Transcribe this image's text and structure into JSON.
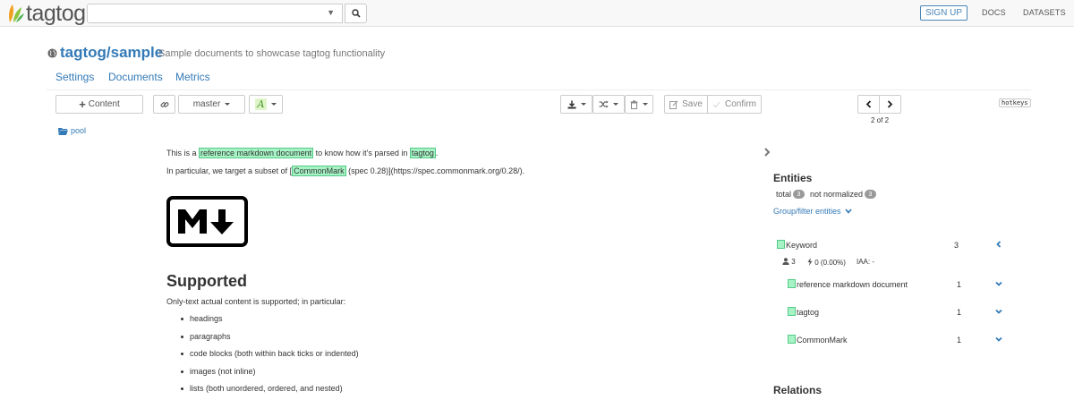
{
  "brand": {
    "name": "tagtog"
  },
  "navbar": {
    "search_value": "",
    "signup_label": "SIGN UP",
    "docs_label": "DOCS",
    "datasets_label": "DATASETS"
  },
  "project": {
    "name": "tagtog/sample",
    "description": "Sample documents to showcase tagtog functionality",
    "tabs": [
      "Settings",
      "Documents",
      "Metrics"
    ]
  },
  "toolbar": {
    "content_label": "Content",
    "branch_label": "master",
    "font_glyph": "A",
    "save_label": "Save",
    "confirm_label": "Confirm",
    "page_indicator": "2 of 2",
    "hotkeys_label": "hotkeys"
  },
  "folder": {
    "label": "pool"
  },
  "document": {
    "line1": {
      "before": "This is a ",
      "hl1": "reference markdown document",
      "middle": " to know how it's parsed in ",
      "hl2": "tagtog",
      "after": "."
    },
    "line2": {
      "before": "In particular, we target a subset of [",
      "hl": "CommonMark",
      "after": " (spec 0.28)](https://spec.commonmark.org/0.28/)."
    },
    "heading": "Supported",
    "intro": "Only-text actual content is supported; in particular:",
    "items": [
      "headings",
      "paragraphs",
      "code blocks (both within back ticks or indented)",
      "images (not inline)",
      "lists (both unordered, ordered, and nested)"
    ]
  },
  "entities_panel": {
    "title": "Entities",
    "total_label": "total",
    "total_count": "3",
    "not_normalized_label": "not normalized",
    "not_normalized_count": "3",
    "group_filter_label": "Group/filter entities",
    "class": {
      "name": "Keyword",
      "count": "3",
      "users": "3",
      "auto": "0 (0.00%)",
      "iaa": "IAA: -"
    },
    "entities": [
      {
        "name": "reference markdown document",
        "count": "1"
      },
      {
        "name": "tagtog",
        "count": "1"
      },
      {
        "name": "CommonMark",
        "count": "1"
      }
    ]
  },
  "relations_panel": {
    "title": "Relations"
  },
  "colors": {
    "accent": "#337ab7",
    "highlight": "#a6f4c5",
    "highlight_border": "#55c988"
  }
}
